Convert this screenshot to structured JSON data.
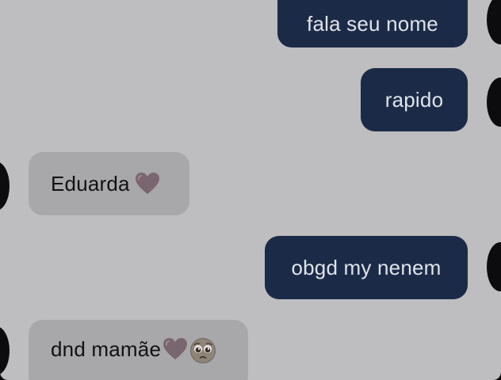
{
  "chat": {
    "messages": [
      {
        "sender": "me",
        "text": "fala seu nome"
      },
      {
        "sender": "me",
        "text": "rapido"
      },
      {
        "sender": "other",
        "text": "Eduarda",
        "emoji": [
          "purple-heart"
        ]
      },
      {
        "sender": "me",
        "text": "obgd my nenem"
      },
      {
        "sender": "other",
        "text": "dnd mamãe",
        "emoji": [
          "purple-heart",
          "pleading-face"
        ]
      }
    ]
  },
  "colors": {
    "background": "#bebdbf",
    "outgoing_bubble": "#1b2b47",
    "incoming_bubble": "#a8a7a9",
    "heart": "#7a6670"
  }
}
